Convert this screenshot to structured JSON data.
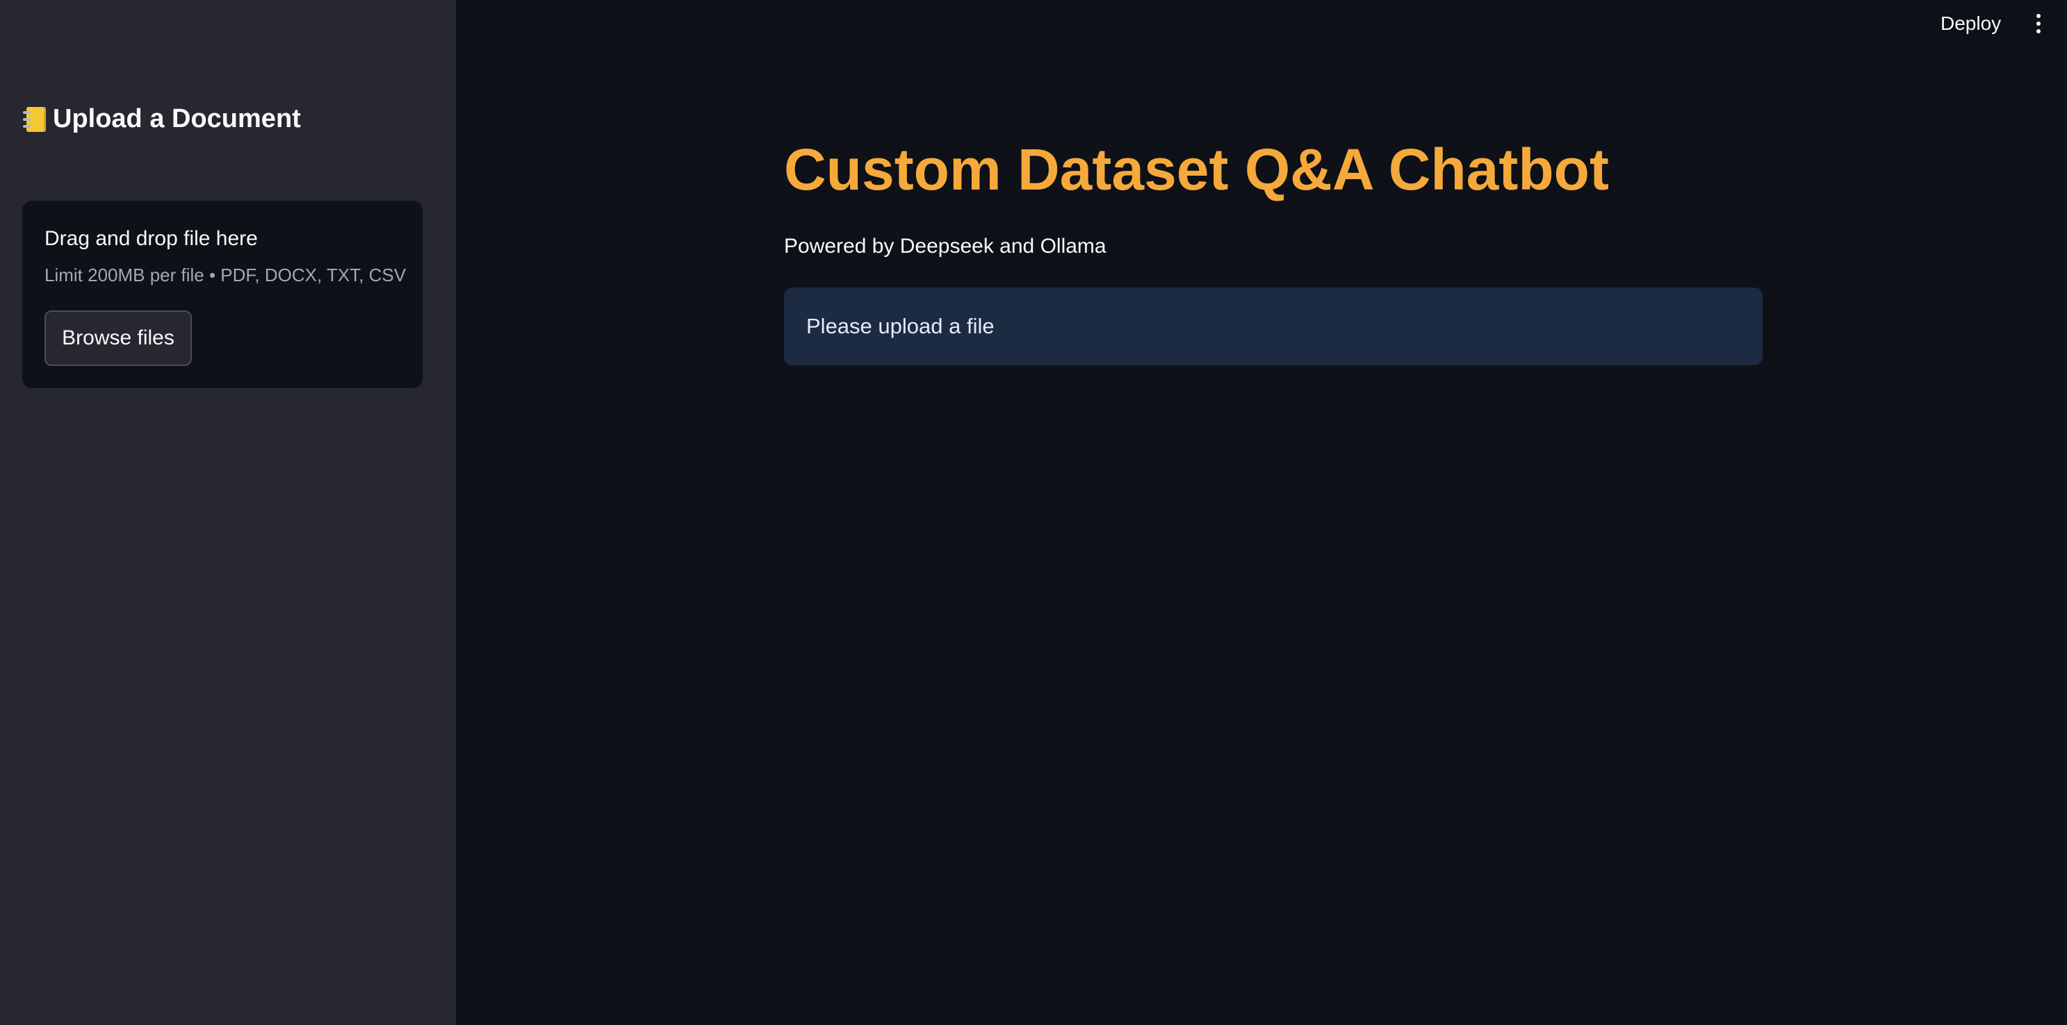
{
  "sidebar": {
    "header": {
      "icon": "notebook-icon",
      "title": "Upload a Document"
    },
    "uploader": {
      "title": "Drag and drop file here",
      "limit_text": "Limit 200MB per file • PDF, DOCX, TXT, CSV",
      "browse_label": "Browse files"
    }
  },
  "toolbar": {
    "deploy_label": "Deploy",
    "menu_icon": "more-vertical-icon"
  },
  "main": {
    "title": "Custom Dataset Q&A Chatbot",
    "subtitle": "Powered by Deepseek and Ollama",
    "info_message": "Please upload a file"
  },
  "colors": {
    "background": "#0e1117",
    "sidebar": "#262730",
    "title_accent": "#f6a93b",
    "info_background": "#1c2b42"
  }
}
